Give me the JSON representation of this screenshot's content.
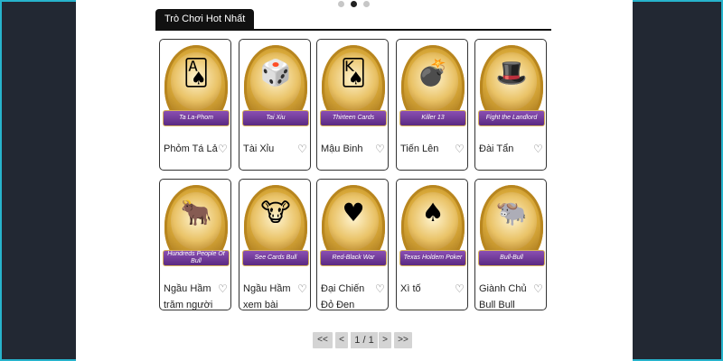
{
  "section": {
    "title": "Trò Chơi Hot Nhất"
  },
  "games": [
    {
      "name": "Phỏm Tá Lả",
      "ribbon": "Ta La-Phom",
      "art": "🂡"
    },
    {
      "name": "Tài Xỉu",
      "ribbon": "Tai Xiu",
      "art": "🎲"
    },
    {
      "name": "Mậu Binh",
      "ribbon": "Thirteen Cards",
      "art": "🂮"
    },
    {
      "name": "Tiến Lên",
      "ribbon": "Killer 13",
      "art": "💣"
    },
    {
      "name": "Đài Tẩn",
      "ribbon": "Fight the Landlord",
      "art": "🎩"
    },
    {
      "name": "Ngầu Hầm trăm người",
      "ribbon": "Hundreds People Of Bull",
      "art": "🐂"
    },
    {
      "name": "Ngầu Hầm xem bài",
      "ribbon": "See Cards Bull",
      "art": "🐮"
    },
    {
      "name": "Đại Chiến Đỏ Đen",
      "ribbon": "Red-Black War",
      "art": "♥"
    },
    {
      "name": "Xì tố",
      "ribbon": "Texas Holdem Poker",
      "art": "♠"
    },
    {
      "name": "Giành Chủ Bull Bull",
      "ribbon": "Bull-Bull",
      "art": "🐃"
    }
  ],
  "favorite_icon": "heart-outline-icon",
  "pagination": {
    "first": "<<",
    "prev": "<",
    "info": "1 / 1",
    "next": ">",
    "last": ">>"
  },
  "colors": {
    "accent_frame": "#27b3cc",
    "tab_bg": "#111111",
    "ribbon": "#6b3a96"
  }
}
